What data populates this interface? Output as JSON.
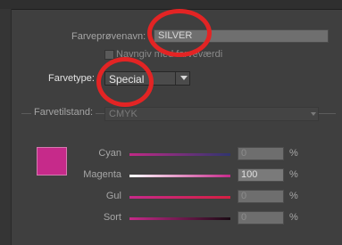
{
  "dialog": {
    "swatch_name_label": "Farveprøvenavn:",
    "swatch_name_value": "SILVER",
    "name_with_value_label": "Navngiv med farveværdi",
    "color_type_label": "Farvetype:",
    "color_type_value": "Special",
    "color_mode_label": "Farvetilstand:",
    "color_mode_value": "CMYK",
    "swatch_color": "#c62a8a"
  },
  "channels": [
    {
      "label": "Cyan",
      "value": "0",
      "unit": "%",
      "gradient": [
        "#c02a86",
        "#30356f"
      ]
    },
    {
      "label": "Magenta",
      "value": "100",
      "unit": "%",
      "gradient": [
        "#ffffff",
        "#c62a8a"
      ]
    },
    {
      "label": "Gul",
      "value": "0",
      "unit": "%",
      "gradient": [
        "#c62a8a",
        "#d51f42"
      ]
    },
    {
      "label": "Sort",
      "value": "0",
      "unit": "%",
      "gradient": [
        "#c62a8a",
        "#1a0a13"
      ]
    }
  ]
}
